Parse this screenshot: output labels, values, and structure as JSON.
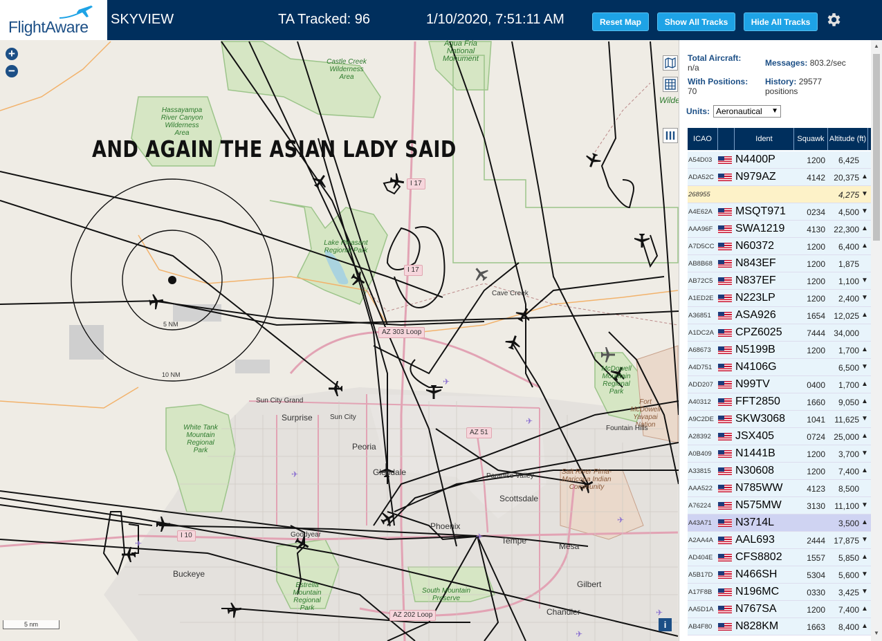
{
  "header": {
    "logo_text": "FlightAware",
    "app_name": "SKYVIEW",
    "tracked": "TA Tracked: 96",
    "datetime": "1/10/2020, 7:51:11 AM",
    "buttons": {
      "reset": "Reset Map",
      "show_all": "Show All Tracks",
      "hide_all": "Hide All Tracks"
    }
  },
  "map": {
    "zoom_in": "+",
    "zoom_out": "−",
    "caption": "AND AGAIN THE ASIAN LADY SAID",
    "ring_inner": "5 NM",
    "ring_outer": "10 NM",
    "scale": "5 nm",
    "info": "i",
    "areas": [
      {
        "id": "agua",
        "text": "Agua Fria National Monument"
      },
      {
        "id": "castle",
        "text": "Castle Creek Wilderness Area"
      },
      {
        "id": "hassa",
        "text": "Hassayampa River Canyon Wilderness Area"
      },
      {
        "id": "pleasant",
        "text": "Lake Pleasant Regional Park"
      },
      {
        "id": "whitetank",
        "text": "White Tank Mountain Regional Park"
      },
      {
        "id": "mcdowell",
        "text": "McDowell Mountain Regional Park"
      },
      {
        "id": "estrella",
        "text": "Estrella Mountain Regional Park"
      },
      {
        "id": "southmtn",
        "text": "South Mountain Preserve"
      },
      {
        "id": "saltriver",
        "text": "Salt River Pima-Maricopa Indian Community"
      },
      {
        "id": "ftmcdowell",
        "text": "Fort McDowell Yavapai Nation"
      },
      {
        "id": "wild",
        "text": "Wilde"
      }
    ],
    "cities": [
      {
        "id": "surprise",
        "text": "Surprise"
      },
      {
        "id": "peoria",
        "text": "Peoria"
      },
      {
        "id": "glendale",
        "text": "Glendale"
      },
      {
        "id": "phoenix",
        "text": "Phoenix"
      },
      {
        "id": "scottsdale",
        "text": "Scottsdale"
      },
      {
        "id": "tempe",
        "text": "Tempe"
      },
      {
        "id": "mesa",
        "text": "Mesa"
      },
      {
        "id": "gilbert",
        "text": "Gilbert"
      },
      {
        "id": "chandler",
        "text": "Chandler"
      },
      {
        "id": "buckeye",
        "text": "Buckeye"
      }
    ],
    "small_places": [
      {
        "id": "suncitygrand",
        "text": "Sun City Grand"
      },
      {
        "id": "suncity",
        "text": "Sun City"
      },
      {
        "id": "cavecreek",
        "text": "Cave Creek"
      },
      {
        "id": "fountainhills",
        "text": "Fountain Hills"
      },
      {
        "id": "paradise",
        "text": "Paradise Valley"
      },
      {
        "id": "goodyear",
        "text": "Goodyear"
      }
    ],
    "shields": [
      {
        "id": "i17a",
        "text": "I 17"
      },
      {
        "id": "i17b",
        "text": "I 17"
      },
      {
        "id": "az303",
        "text": "AZ 303 Loop"
      },
      {
        "id": "az51",
        "text": "AZ 51"
      },
      {
        "id": "i10",
        "text": "I 10"
      },
      {
        "id": "az202",
        "text": "AZ 202 Loop"
      }
    ]
  },
  "stats": {
    "total_label": "Total Aircraft:",
    "total_value": "n/a",
    "messages_label": "Messages:",
    "messages_value": "803.2/sec",
    "positions_label": "With Positions:",
    "positions_value": "70",
    "history_label": "History:",
    "history_value": "29577 positions",
    "units_label": "Units:",
    "units_value": "Aeronautical"
  },
  "table": {
    "headers": {
      "icao": "ICAO",
      "ident": "Ident",
      "squawk": "Squawk",
      "altitude": "Altitude (ft)"
    },
    "rows": [
      {
        "icao": "A54D03",
        "ident": "N4400P",
        "squawk": "1200",
        "alt": "6,425",
        "trend": ""
      },
      {
        "icao": "ADA52C",
        "ident": "N979AZ",
        "squawk": "4142",
        "alt": "20,375",
        "trend": "▲"
      },
      {
        "icao": "268955",
        "ident": "",
        "squawk": "",
        "alt": "4,275",
        "trend": "▼"
      },
      {
        "icao": "A4E62A",
        "ident": "MSQT971",
        "squawk": "0234",
        "alt": "4,500",
        "trend": "▼"
      },
      {
        "icao": "AAA96F",
        "ident": "SWA1219",
        "squawk": "4130",
        "alt": "22,300",
        "trend": "▲"
      },
      {
        "icao": "A7D5CC",
        "ident": "N60372",
        "squawk": "1200",
        "alt": "6,400",
        "trend": "▲"
      },
      {
        "icao": "AB8B68",
        "ident": "N843EF",
        "squawk": "1200",
        "alt": "1,875",
        "trend": ""
      },
      {
        "icao": "AB72C5",
        "ident": "N837EF",
        "squawk": "1200",
        "alt": "1,100",
        "trend": "▼"
      },
      {
        "icao": "A1ED2E",
        "ident": "N223LP",
        "squawk": "1200",
        "alt": "2,400",
        "trend": "▼"
      },
      {
        "icao": "A36851",
        "ident": "ASA926",
        "squawk": "1654",
        "alt": "12,025",
        "trend": "▲"
      },
      {
        "icao": "A1DC2A",
        "ident": "CPZ6025",
        "squawk": "7444",
        "alt": "34,000",
        "trend": ""
      },
      {
        "icao": "A68673",
        "ident": "N5199B",
        "squawk": "1200",
        "alt": "1,700",
        "trend": "▲"
      },
      {
        "icao": "A4D751",
        "ident": "N4106G",
        "squawk": "",
        "alt": "6,500",
        "trend": "▼"
      },
      {
        "icao": "ADD207",
        "ident": "N99TV",
        "squawk": "0400",
        "alt": "1,700",
        "trend": "▲"
      },
      {
        "icao": "A40312",
        "ident": "FFT2850",
        "squawk": "1660",
        "alt": "9,050",
        "trend": "▲"
      },
      {
        "icao": "A9C2DE",
        "ident": "SKW3068",
        "squawk": "1041",
        "alt": "11,625",
        "trend": "▼"
      },
      {
        "icao": "A28392",
        "ident": "JSX405",
        "squawk": "0724",
        "alt": "25,000",
        "trend": "▲"
      },
      {
        "icao": "A0B409",
        "ident": "N1441B",
        "squawk": "1200",
        "alt": "3,700",
        "trend": "▼"
      },
      {
        "icao": "A33815",
        "ident": "N30608",
        "squawk": "1200",
        "alt": "7,400",
        "trend": "▲"
      },
      {
        "icao": "AAA522",
        "ident": "N785WW",
        "squawk": "4123",
        "alt": "8,500",
        "trend": ""
      },
      {
        "icao": "A76224",
        "ident": "N575MW",
        "squawk": "3130",
        "alt": "11,100",
        "trend": "▼"
      },
      {
        "icao": "A43A71",
        "ident": "N3714L",
        "squawk": "",
        "alt": "3,500",
        "trend": "▲"
      },
      {
        "icao": "A2AA4A",
        "ident": "AAL693",
        "squawk": "2444",
        "alt": "17,875",
        "trend": "▼"
      },
      {
        "icao": "AD404E",
        "ident": "CFS8802",
        "squawk": "1557",
        "alt": "5,850",
        "trend": "▲"
      },
      {
        "icao": "A5B17D",
        "ident": "N466SH",
        "squawk": "5304",
        "alt": "5,600",
        "trend": "▼"
      },
      {
        "icao": "A17F8B",
        "ident": "N196MC",
        "squawk": "0330",
        "alt": "3,425",
        "trend": "▼"
      },
      {
        "icao": "AA5D1A",
        "ident": "N767SA",
        "squawk": "1200",
        "alt": "7,400",
        "trend": "▲"
      },
      {
        "icao": "AB4F80",
        "ident": "N828KM",
        "squawk": "1663",
        "alt": "8,400",
        "trend": "▲"
      }
    ]
  },
  "colors": {
    "header_bg": "#002f5d",
    "button": "#1ea3e6",
    "highlight_yellow": "#fdf2c8",
    "highlight_selected": "#cfd3f2",
    "park_green": "#cfe3b8",
    "urban_pink": "#e2a3b4"
  }
}
